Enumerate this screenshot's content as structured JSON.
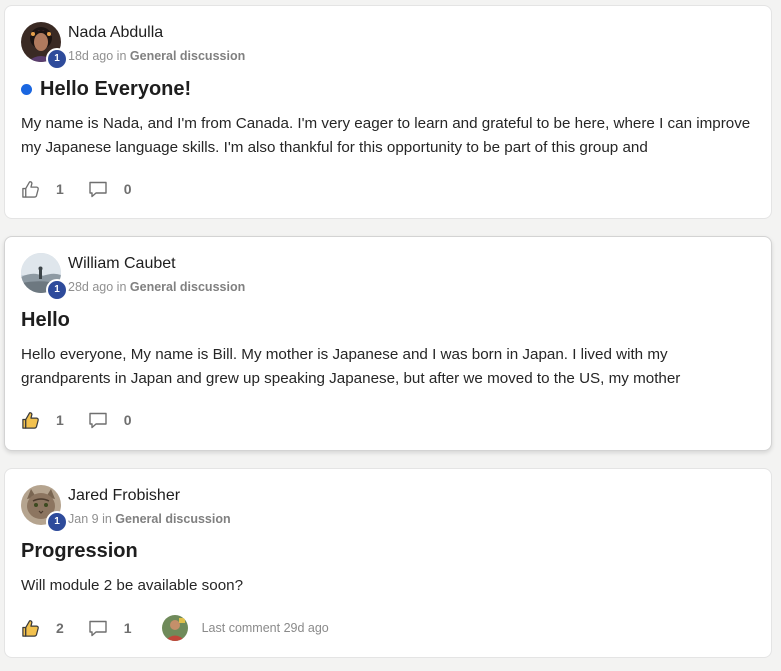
{
  "posts": [
    {
      "author": "Nada Abdulla",
      "level": "1",
      "time": "18d ago",
      "in_text": "in",
      "category": "General discussion",
      "title": "Hello Everyone!",
      "unread": true,
      "body": "My name is Nada, and I'm from Canada. I'm very eager to learn and grateful to be here, where I can improve my Japanese language skills. I'm also thankful for this opportunity to be part of this group and",
      "likes": "1",
      "liked": false,
      "comments": "0"
    },
    {
      "author": "William Caubet",
      "level": "1",
      "time": "28d ago",
      "in_text": "in",
      "category": "General discussion",
      "title": "Hello",
      "unread": false,
      "body": "Hello everyone, My name is Bill. My mother is Japanese and I was born in Japan. I lived with my grandparents in Japan and grew up speaking Japanese, but after we moved to the US, my mother",
      "likes": "1",
      "liked": true,
      "comments": "0"
    },
    {
      "author": "Jared Frobisher",
      "level": "1",
      "time": "Jan 9",
      "in_text": "in",
      "category": "General discussion",
      "title": "Progression",
      "unread": false,
      "body": "Will module 2 be available soon?",
      "likes": "2",
      "liked": true,
      "comments": "1",
      "last_comment": "Last comment 29d ago"
    }
  ],
  "colors": {
    "unread_dot": "#1a66e0",
    "level_badge": "#2e4b9b",
    "liked_thumb": "#f2c14e"
  },
  "icons": {
    "like": "thumbs-up-icon",
    "comment": "comment-bubble-icon"
  }
}
